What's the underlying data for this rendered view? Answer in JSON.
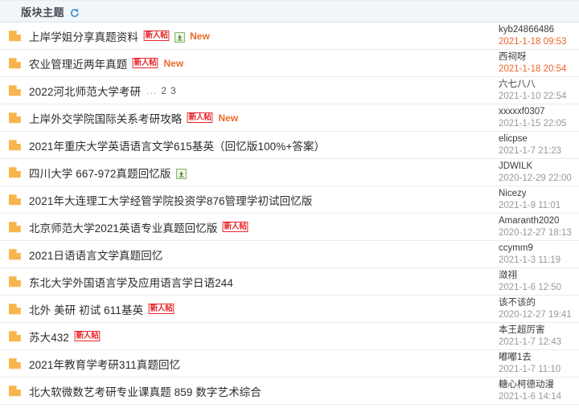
{
  "header": {
    "title": "版块主题",
    "refresh_icon": "refresh-loop-icon"
  },
  "icons": {
    "folder": "folder-icon",
    "attachment": "image-attachment-icon"
  },
  "labels": {
    "new_user_badge": "新人帖",
    "new_flag": "New",
    "pages_dots": "...",
    "page_2": "2",
    "page_3": "3"
  },
  "colors": {
    "badge_red": "#e8252a",
    "new_orange": "#ec6a2c",
    "recent_date": "#f0622b",
    "old_date": "#999999",
    "header_bg": "#f2f6f9",
    "row_border": "#e4edf3",
    "folder_orange": "#f7b44d"
  },
  "threads": [
    {
      "title": "上岸学姐分享真题资料",
      "new_user": true,
      "attachment": true,
      "is_new": true,
      "pages": null,
      "author": "kyb24866486",
      "date": "2021-1-18 09:53",
      "date_recent": true
    },
    {
      "title": "农业管理近两年真题",
      "new_user": true,
      "attachment": false,
      "is_new": true,
      "pages": null,
      "author": "西祠呀",
      "date": "2021-1-18 20:54",
      "date_recent": true
    },
    {
      "title": "2022河北师范大学考研",
      "new_user": false,
      "attachment": false,
      "is_new": false,
      "pages": [
        "...",
        "2",
        "3"
      ],
      "author": "六七八八",
      "date": "2021-1-10 22:54",
      "date_recent": false
    },
    {
      "title": "上岸外交学院国际关系考研攻略",
      "new_user": true,
      "attachment": false,
      "is_new": true,
      "pages": null,
      "author": "xxxxxf0307",
      "date": "2021-1-15 22:05",
      "date_recent": false
    },
    {
      "title": "2021年重庆大学英语语言文学615基英（回忆版100%+答案）",
      "new_user": false,
      "attachment": false,
      "is_new": false,
      "pages": null,
      "author": "elicpse",
      "date": "2021-1-7 21:23",
      "date_recent": false
    },
    {
      "title": "四川大学 667-972真题回忆版",
      "new_user": false,
      "attachment": true,
      "is_new": false,
      "pages": null,
      "author": "JDWILK",
      "date": "2020-12-29 22:00",
      "date_recent": false
    },
    {
      "title": "2021年大连理工大学经管学院投资学876管理学初试回忆版",
      "new_user": false,
      "attachment": false,
      "is_new": false,
      "pages": null,
      "author": "Nicezy",
      "date": "2021-1-9 11:01",
      "date_recent": false
    },
    {
      "title": "北京师范大学2021英语专业真题回忆版",
      "new_user": true,
      "attachment": false,
      "is_new": false,
      "pages": null,
      "author": "Amaranth2020",
      "date": "2020-12-27 18:13",
      "date_recent": false
    },
    {
      "title": "2021日语语言文学真题回忆",
      "new_user": false,
      "attachment": false,
      "is_new": false,
      "pages": null,
      "author": "ccymm9",
      "date": "2021-1-3 11:19",
      "date_recent": false
    },
    {
      "title": "东北大学外国语言学及应用语言学日语244",
      "new_user": false,
      "attachment": false,
      "is_new": false,
      "pages": null,
      "author": "潋祤",
      "date": "2021-1-6 12:50",
      "date_recent": false
    },
    {
      "title": "北外 美研 初试 611基英",
      "new_user": true,
      "attachment": false,
      "is_new": false,
      "pages": null,
      "author": "该不该的",
      "date": "2020-12-27 19:41",
      "date_recent": false
    },
    {
      "title": "苏大432",
      "new_user": true,
      "attachment": false,
      "is_new": false,
      "pages": null,
      "author": "本王超厉害",
      "date": "2021-1-7 12:43",
      "date_recent": false
    },
    {
      "title": "2021年教育学考研311真题回忆",
      "new_user": false,
      "attachment": false,
      "is_new": false,
      "pages": null,
      "author": "嘟嘟1去",
      "date": "2021-1-7 11:10",
      "date_recent": false
    },
    {
      "title": "北大软微数艺考研专业课真题 859 数字艺术综合",
      "new_user": false,
      "attachment": false,
      "is_new": false,
      "pages": null,
      "author": "糖心柯德动漫",
      "date": "2021-1-6 14:14",
      "date_recent": false
    }
  ]
}
